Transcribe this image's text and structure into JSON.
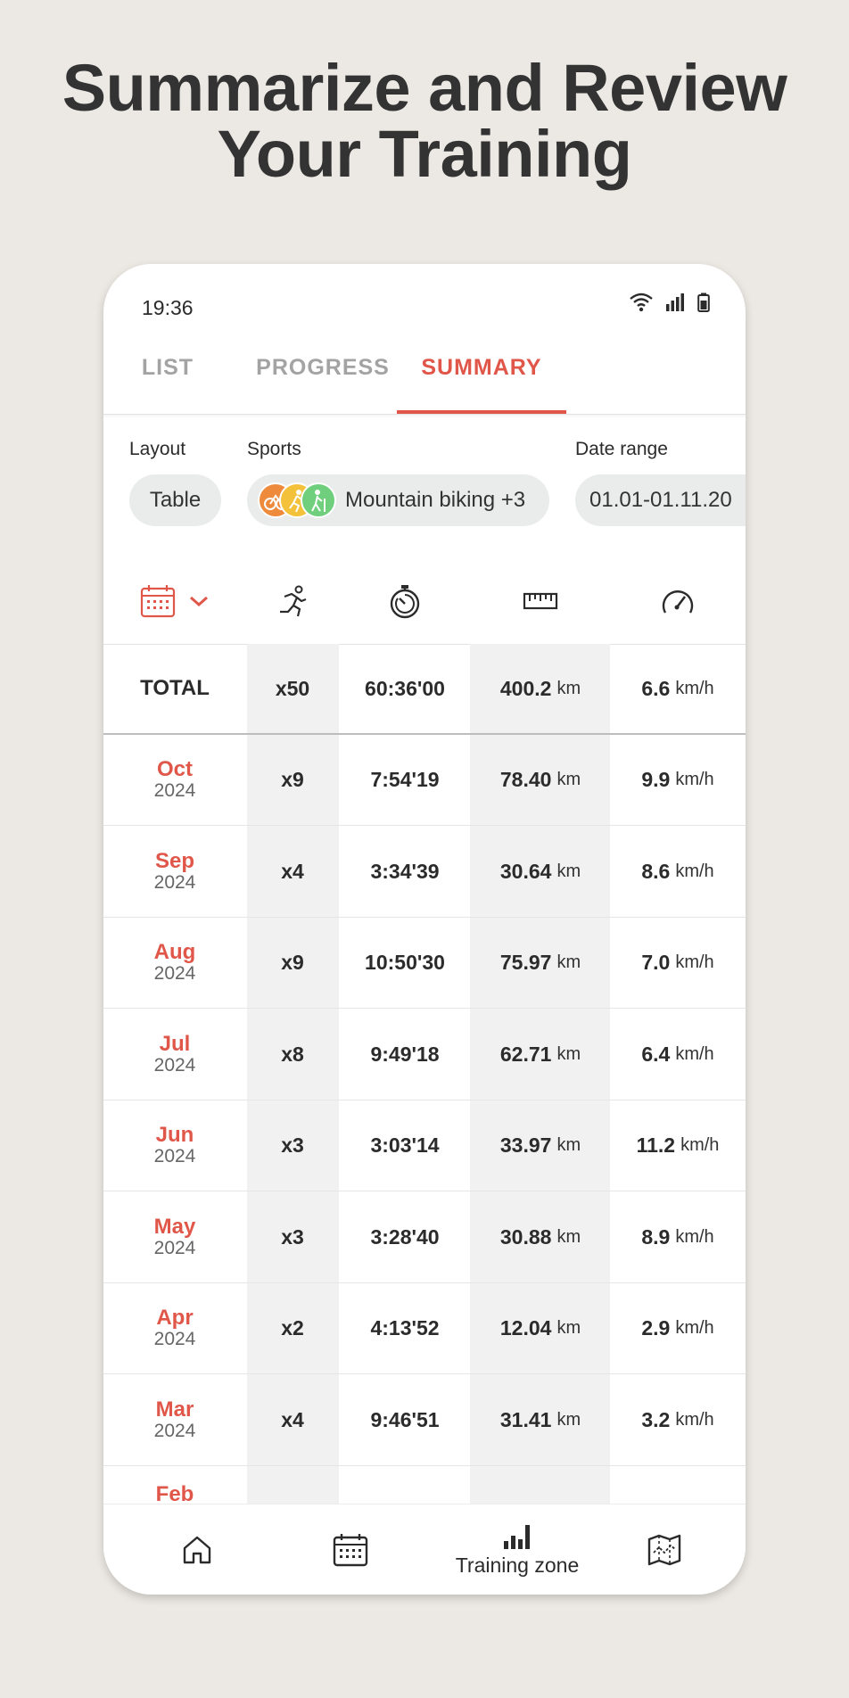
{
  "headline": {
    "line1": "Summarize and Review",
    "line2": "Your Training"
  },
  "status": {
    "time": "19:36"
  },
  "tabs": [
    {
      "label": "LIST"
    },
    {
      "label": "PROGRESS"
    },
    {
      "label": "SUMMARY",
      "active": true
    }
  ],
  "filters": {
    "layout_label": "Layout",
    "layout_value": "Table",
    "sports_label": "Sports",
    "sports_value": "Mountain biking +3",
    "sport_icons": [
      "cycling-icon",
      "running-icon",
      "hiking-icon"
    ],
    "date_label": "Date range",
    "date_value": "01.01-01.11.20"
  },
  "columns": [
    "calendar-icon",
    "runner-icon",
    "stopwatch-icon",
    "ruler-icon",
    "speedometer-icon"
  ],
  "total": {
    "label": "TOTAL",
    "count": "x50",
    "duration": "60:36'00",
    "distance": "400.2",
    "distance_unit": "km",
    "speed": "6.6",
    "speed_unit": "km/h"
  },
  "rows": [
    {
      "month": "Oct",
      "year": "2024",
      "count": "x9",
      "duration": "7:54'19",
      "distance": "78.40",
      "distance_unit": "km",
      "speed": "9.9",
      "speed_unit": "km/h"
    },
    {
      "month": "Sep",
      "year": "2024",
      "count": "x4",
      "duration": "3:34'39",
      "distance": "30.64",
      "distance_unit": "km",
      "speed": "8.6",
      "speed_unit": "km/h"
    },
    {
      "month": "Aug",
      "year": "2024",
      "count": "x9",
      "duration": "10:50'30",
      "distance": "75.97",
      "distance_unit": "km",
      "speed": "7.0",
      "speed_unit": "km/h"
    },
    {
      "month": "Jul",
      "year": "2024",
      "count": "x8",
      "duration": "9:49'18",
      "distance": "62.71",
      "distance_unit": "km",
      "speed": "6.4",
      "speed_unit": "km/h"
    },
    {
      "month": "Jun",
      "year": "2024",
      "count": "x3",
      "duration": "3:03'14",
      "distance": "33.97",
      "distance_unit": "km",
      "speed": "11.2",
      "speed_unit": "km/h"
    },
    {
      "month": "May",
      "year": "2024",
      "count": "x3",
      "duration": "3:28'40",
      "distance": "30.88",
      "distance_unit": "km",
      "speed": "8.9",
      "speed_unit": "km/h"
    },
    {
      "month": "Apr",
      "year": "2024",
      "count": "x2",
      "duration": "4:13'52",
      "distance": "12.04",
      "distance_unit": "km",
      "speed": "2.9",
      "speed_unit": "km/h"
    },
    {
      "month": "Mar",
      "year": "2024",
      "count": "x4",
      "duration": "9:46'51",
      "distance": "31.41",
      "distance_unit": "km",
      "speed": "3.2",
      "speed_unit": "km/h"
    },
    {
      "month": "Feb",
      "year": "",
      "count": "",
      "duration": "",
      "distance": "",
      "distance_unit": "",
      "speed": "",
      "speed_unit": ""
    }
  ],
  "bottom_nav": [
    {
      "icon": "home-icon",
      "label": ""
    },
    {
      "icon": "calendar-icon",
      "label": ""
    },
    {
      "icon": "bar-chart-icon",
      "label": "Training zone",
      "active": true
    },
    {
      "icon": "map-icon",
      "label": ""
    }
  ],
  "colors": {
    "accent": "#e0574a",
    "background": "#ece8e3"
  }
}
